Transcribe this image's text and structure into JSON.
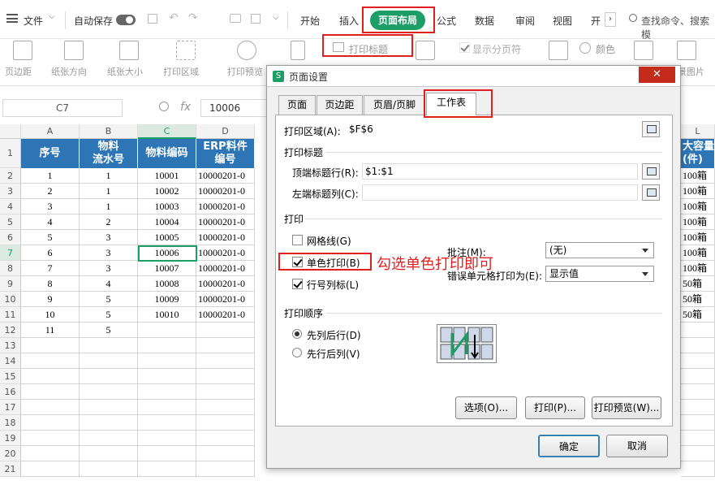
{
  "topbar": {
    "menu_file": "文件",
    "autosave": "自动保存",
    "tabs": [
      "开始",
      "插入",
      "页面布局",
      "公式",
      "数据",
      "审阅",
      "视图",
      "开"
    ],
    "search": "查找命令、搜索模"
  },
  "ribbon": {
    "items": [
      "页边距",
      "纸张方向",
      "纸张大小",
      "打印区域",
      "打印预览"
    ],
    "print_title": "打印标题",
    "show_breaks": "显示分页符",
    "color": "颜色",
    "bg_image": "景图片"
  },
  "formula": {
    "cell_ref": "C7",
    "fx": "fx",
    "value": "10006"
  },
  "columns": [
    "A",
    "B",
    "C",
    "D",
    "L"
  ],
  "headers": {
    "a": "序号",
    "b": "物料\n流水号",
    "c": "物料编码",
    "d": "ERP料件\n编号",
    "l": "大容量\n(件)"
  },
  "rows": [
    {
      "a": "1",
      "b": "1",
      "c": "10001",
      "d": "10000201-0",
      "l": "100箱"
    },
    {
      "a": "2",
      "b": "1",
      "c": "10002",
      "d": "10000201-0",
      "l": "100箱"
    },
    {
      "a": "3",
      "b": "1",
      "c": "10003",
      "d": "10000201-0",
      "l": "100箱"
    },
    {
      "a": "4",
      "b": "2",
      "c": "10004",
      "d": "10000201-0",
      "l": "100箱"
    },
    {
      "a": "5",
      "b": "3",
      "c": "10005",
      "d": "10000201-0",
      "l": "100箱"
    },
    {
      "a": "6",
      "b": "3",
      "c": "10006",
      "d": "10000201-0",
      "l": "100箱"
    },
    {
      "a": "7",
      "b": "3",
      "c": "10007",
      "d": "10000201-0",
      "l": "100箱"
    },
    {
      "a": "8",
      "b": "4",
      "c": "10008",
      "d": "10000201-0",
      "l": "50箱"
    },
    {
      "a": "9",
      "b": "5",
      "c": "10009",
      "d": "10000201-0",
      "l": "50箱"
    },
    {
      "a": "10",
      "b": "5",
      "c": "10010",
      "d": "10000201-0",
      "l": "50箱"
    },
    {
      "a": "11",
      "b": "5",
      "c": "",
      "d": "",
      "l": ""
    }
  ],
  "row_numbers": [
    "1",
    "2",
    "3",
    "4",
    "5",
    "6",
    "7",
    "8",
    "9",
    "10",
    "11",
    "12",
    "13",
    "14",
    "15",
    "16",
    "17",
    "18",
    "19",
    "20",
    "21"
  ],
  "dialog": {
    "title": "页面设置",
    "tabs": [
      "页面",
      "页边距",
      "页眉/页脚",
      "工作表"
    ],
    "print_area_label": "打印区域(A):",
    "print_area_value": "$F$6",
    "print_titles_label": "打印标题",
    "top_rows_label": "顶端标题行(R):",
    "top_rows_value": "$1:$1",
    "left_cols_label": "左端标题列(C):",
    "print_label": "打印",
    "gridlines_label": "网格线(G)",
    "mono_label": "单色打印(B)",
    "rowcol_label": "行号列标(L)",
    "comments_label": "批注(M):",
    "comments_value": "(无)",
    "errors_label": "错误单元格打印为(E):",
    "errors_value": "显示值",
    "order_label": "打印顺序",
    "order_down": "先列后行(D)",
    "order_over": "先行后列(V)",
    "btn_options": "选项(O)...",
    "btn_print": "打印(P)...",
    "btn_preview": "打印预览(W)...",
    "btn_ok": "确定",
    "btn_cancel": "取消"
  },
  "annotation": "勾选单色打印即可"
}
